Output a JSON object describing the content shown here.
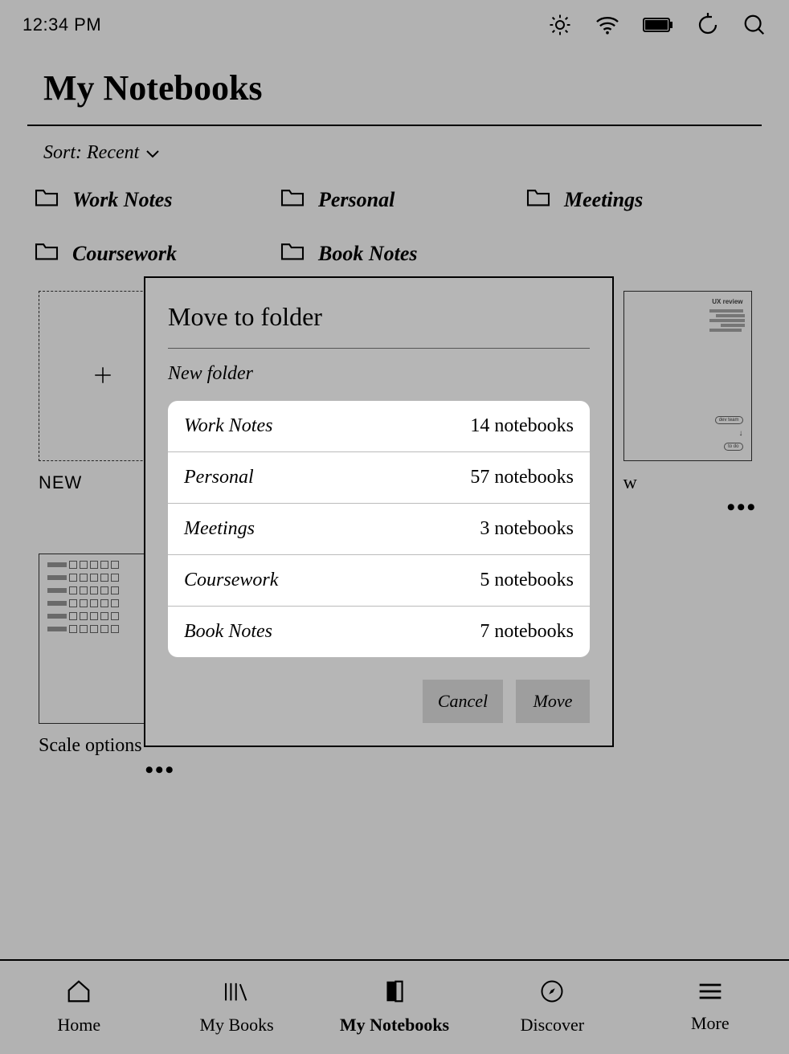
{
  "status_bar": {
    "time": "12:34 PM"
  },
  "page": {
    "title": "My Notebooks",
    "sort_label": "Sort: Recent"
  },
  "folders_row": [
    {
      "label": "Work Notes"
    },
    {
      "label": "Personal"
    },
    {
      "label": "Meetings"
    },
    {
      "label": "Coursework"
    },
    {
      "label": "Book Notes"
    }
  ],
  "notebooks": {
    "new_label": "NEW",
    "items": [
      {
        "label": "w",
        "title_snippet": "UX review"
      },
      {
        "label": "Scale options",
        "title_snippet": ""
      }
    ]
  },
  "dialog": {
    "title": "Move to folder",
    "new_folder_label": "New folder",
    "folders": [
      {
        "name": "Work Notes",
        "count_label": "14 notebooks"
      },
      {
        "name": "Personal",
        "count_label": "57 notebooks"
      },
      {
        "name": "Meetings",
        "count_label": "3 notebooks"
      },
      {
        "name": "Coursework",
        "count_label": "5 notebooks"
      },
      {
        "name": "Book Notes",
        "count_label": "7 notebooks"
      }
    ],
    "cancel_label": "Cancel",
    "move_label": "Move"
  },
  "tabs": [
    {
      "label": "Home"
    },
    {
      "label": "My Books"
    },
    {
      "label": "My Notebooks"
    },
    {
      "label": "Discover"
    },
    {
      "label": "More"
    }
  ]
}
